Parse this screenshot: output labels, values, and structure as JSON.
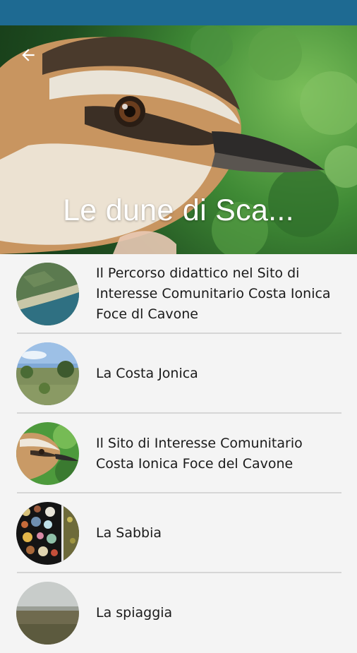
{
  "header": {
    "back_icon": "arrow-left-icon",
    "title": "Le dune di Sca..."
  },
  "colors": {
    "status_bar": "#1e6a92",
    "list_background": "#f4f4f4",
    "divider": "#d6d6d6",
    "title_text": "#ffffff"
  },
  "items": [
    {
      "label": "Il Percorso didattico nel Sito di Interesse Comunitario Costa Ionica Foce dl Cavone",
      "thumbnail": "aerial-coast-image"
    },
    {
      "label": "La Costa Jonica",
      "thumbnail": "coastal-scrub-image"
    },
    {
      "label": "Il Sito di Interesse Comunitario Costa Ionica Foce del Cavone",
      "thumbnail": "bird-image"
    },
    {
      "label": "La Sabbia",
      "thumbnail": "sand-grains-image"
    },
    {
      "label": "La spiaggia",
      "thumbnail": "beach-image"
    }
  ]
}
